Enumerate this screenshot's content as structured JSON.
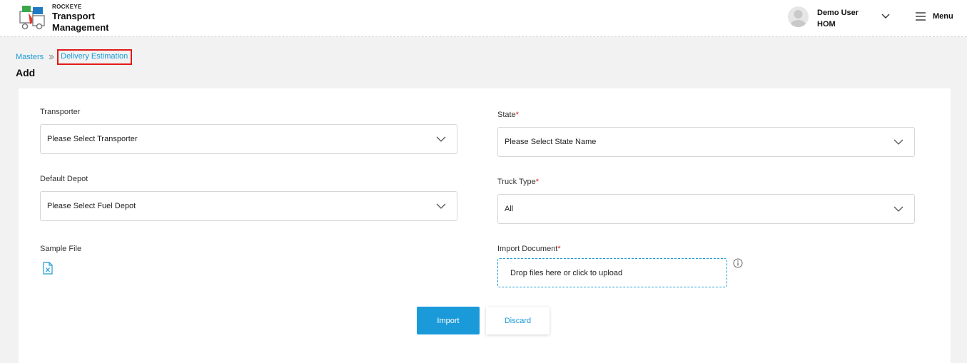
{
  "header": {
    "brand_small": "ROCKEYE",
    "brand_line1": "Transport",
    "brand_line2": "Management",
    "user_name": "Demo User",
    "user_role": "HOM",
    "menu_label": "Menu"
  },
  "breadcrumb": {
    "parent": "Masters",
    "current": "Delivery Estimation"
  },
  "page_title": "Add",
  "form": {
    "transporter": {
      "label": "Transporter",
      "value": "Please Select Transporter"
    },
    "default_depot": {
      "label": "Default Depot",
      "value": "Please Select Fuel Depot"
    },
    "sample_file": {
      "label": "Sample File"
    },
    "state": {
      "label": "State",
      "required_mark": "*",
      "value": "Please Select State Name"
    },
    "truck_type": {
      "label": "Truck Type",
      "required_mark": "*",
      "value": "All"
    },
    "import_document": {
      "label": "Import Document",
      "required_mark": "*",
      "dropzone_text": "Drop files here or click to upload"
    }
  },
  "buttons": {
    "import": "Import",
    "discard": "Discard"
  },
  "colors": {
    "accent": "#1b9ad9",
    "required": "#e11919",
    "highlight_box": "#e11919"
  }
}
